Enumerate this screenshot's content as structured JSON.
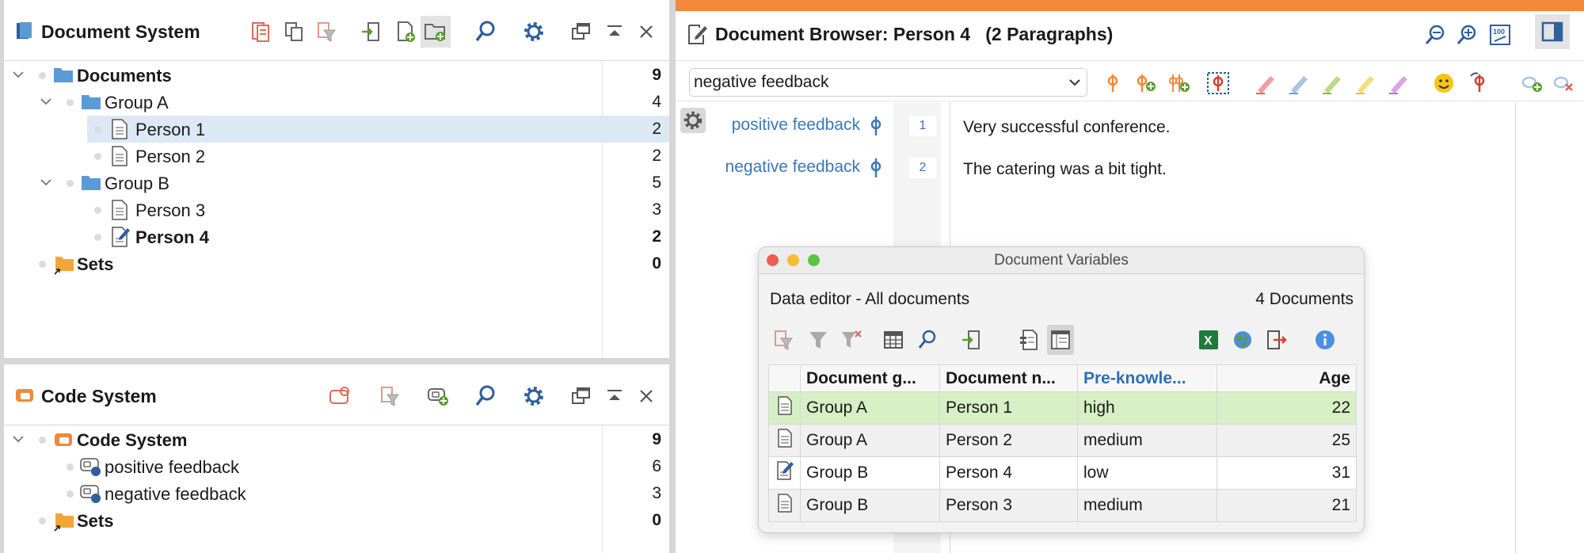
{
  "document_system": {
    "title": "Document System",
    "tree": [
      {
        "label": "Documents",
        "count": "9"
      },
      {
        "label": "Group A",
        "count": "4"
      },
      {
        "label": "Person 1",
        "count": "2"
      },
      {
        "label": "Person 2",
        "count": "2"
      },
      {
        "label": "Group B",
        "count": "5"
      },
      {
        "label": "Person 3",
        "count": "3"
      },
      {
        "label": "Person 4",
        "count": "2"
      },
      {
        "label": "Sets",
        "count": "0"
      }
    ]
  },
  "code_system": {
    "title": "Code System",
    "tree": [
      {
        "label": "Code System",
        "count": "9"
      },
      {
        "label": "positive feedback",
        "count": "6"
      },
      {
        "label": "negative feedback",
        "count": "3"
      },
      {
        "label": "Sets",
        "count": "0"
      }
    ]
  },
  "browser": {
    "title": "Document Browser: Person 4   (2 Paragraphs)",
    "code_select": "negative feedback",
    "codes": [
      {
        "label": "positive feedback"
      },
      {
        "label": "negative feedback"
      }
    ],
    "paragraphs": [
      {
        "num": "1",
        "text": "Very successful conference."
      },
      {
        "num": "2",
        "text": "The catering was a bit tight."
      }
    ]
  },
  "dialog": {
    "title": "Document Variables",
    "subtitle": "Data editor - All documents",
    "count": "4 Documents",
    "columns": [
      "Document g...",
      "Document n...",
      "Pre-knowle...",
      "Age"
    ],
    "rows": [
      {
        "group": "Group A",
        "name": "Person 1",
        "pre": "high",
        "age": "22"
      },
      {
        "group": "Group A",
        "name": "Person 2",
        "pre": "medium",
        "age": "25"
      },
      {
        "group": "Group B",
        "name": "Person 4",
        "pre": "low",
        "age": "31"
      },
      {
        "group": "Group B",
        "name": "Person 3",
        "pre": "medium",
        "age": "21"
      }
    ]
  },
  "colors": {
    "accent_orange": "#f0893a",
    "folder_blue": "#5b9bd5",
    "link_blue": "#3a78b8",
    "selection_blue": "#dde8f5",
    "selection_green": "#d6efc4"
  }
}
